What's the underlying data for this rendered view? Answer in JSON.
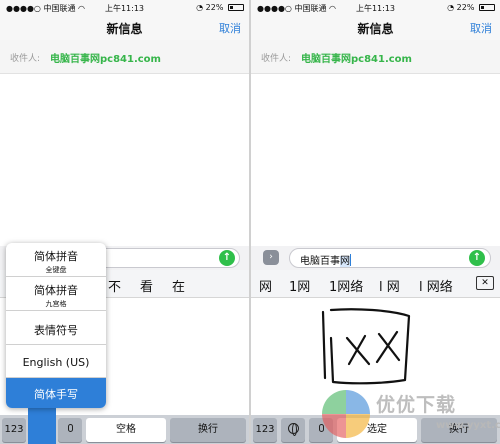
{
  "status": {
    "carrier": "中国联通",
    "time": "上午11:13",
    "battery": "22%",
    "battery_level": 0.22
  },
  "nav": {
    "title": "新信息",
    "cancel": "取消"
  },
  "recipient": {
    "label": "收件人:",
    "value": "电脑百事网pc841.com"
  },
  "left": {
    "candidates": [
      "不",
      "看",
      "在"
    ],
    "input_menu": [
      {
        "main": "简体拼音",
        "sub": "全键盘"
      },
      {
        "main": "简体拼音",
        "sub": "九宫格"
      },
      {
        "main": "表情符号",
        "sub": ""
      },
      {
        "main": "English (US)",
        "sub": ""
      },
      {
        "main": "简体手写",
        "sub": "",
        "selected": true
      }
    ],
    "keys": {
      "num": "123",
      "space": "空格",
      "return": "换行"
    }
  },
  "right": {
    "input_prefix": "电脑百事",
    "input_active": "网",
    "candidates": [
      "网",
      "1网",
      "1网络",
      "l 网",
      "l 网络"
    ],
    "keys": {
      "num": "123",
      "select": "选定",
      "return": "换行"
    }
  },
  "watermark": {
    "text": "优优下载",
    "sub": "www.yyxt.com"
  },
  "colors": {
    "accent": "#2e7fd8",
    "link_green": "#36b54a",
    "send_green": "#2fbf4a"
  },
  "icons": [
    "wifi-icon",
    "alarm-icon",
    "battery-icon",
    "send-arrow-icon",
    "expand-chevron-icon",
    "globe-icon",
    "microphone-icon",
    "delete-icon"
  ]
}
